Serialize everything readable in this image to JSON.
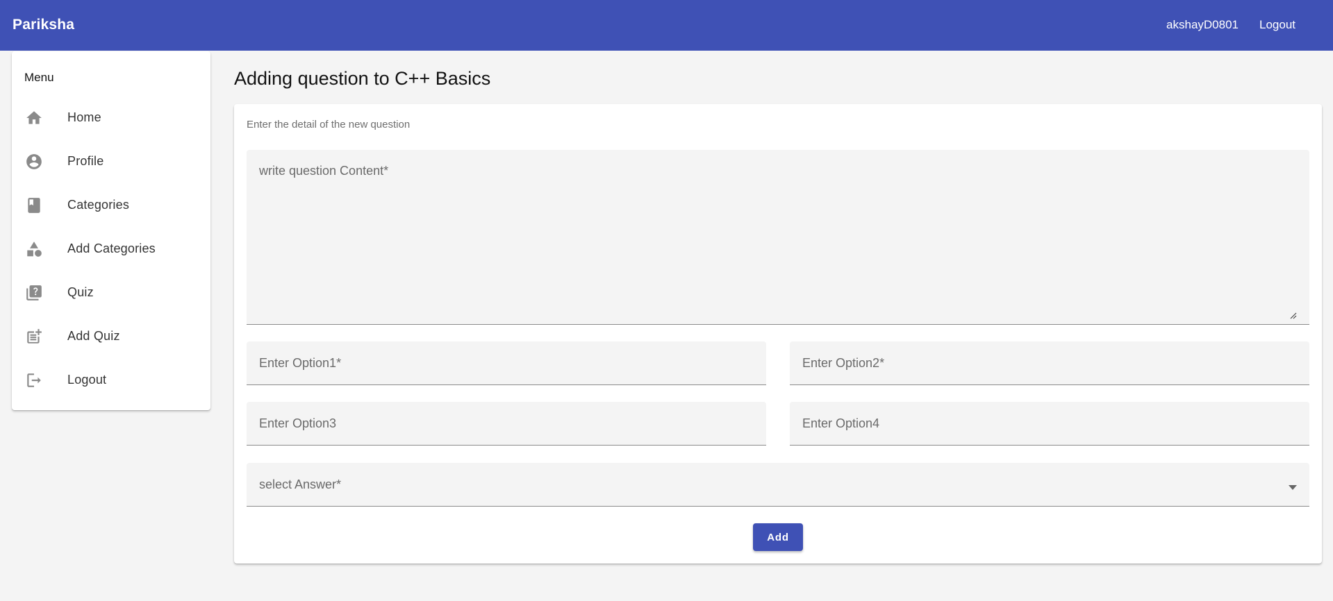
{
  "header": {
    "brand": "Pariksha",
    "username": "akshayD0801",
    "logout_label": "Logout",
    "color": "#3f51b5"
  },
  "sidebar": {
    "title": "Menu",
    "items": [
      {
        "label": "Home",
        "icon": "home-icon"
      },
      {
        "label": "Profile",
        "icon": "account-circle-icon"
      },
      {
        "label": "Categories",
        "icon": "book-icon"
      },
      {
        "label": "Add Categories",
        "icon": "category-shapes-icon"
      },
      {
        "label": "Quiz",
        "icon": "quiz-icon"
      },
      {
        "label": "Add Quiz",
        "icon": "post-add-icon"
      },
      {
        "label": "Logout",
        "icon": "logout-icon"
      }
    ]
  },
  "main": {
    "title": "Adding question to C++ Basics",
    "form": {
      "subtitle": "Enter the detail of the new question",
      "content_placeholder": "write question Content*",
      "option1_placeholder": "Enter Option1*",
      "option2_placeholder": "Enter Option2*",
      "option3_placeholder": "Enter Option3",
      "option4_placeholder": "Enter Option4",
      "answer_placeholder": "select Answer*",
      "add_label": "Add"
    }
  }
}
